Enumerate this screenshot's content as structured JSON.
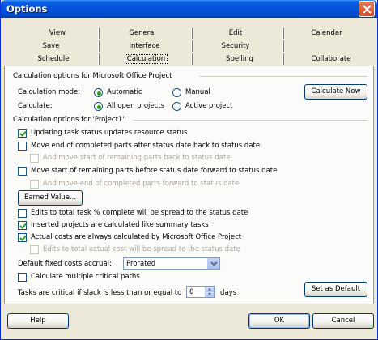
{
  "window": {
    "title": "Options"
  },
  "tabs": {
    "row1": [
      "View",
      "General",
      "Edit",
      "Calendar"
    ],
    "row2": [
      "Save",
      "Interface",
      "Security"
    ],
    "row3": [
      "Schedule",
      "Calculation",
      "Spelling",
      "Collaborate"
    ],
    "selected": "Calculation"
  },
  "calc_options": {
    "title": "Calculation options for Microsoft Office Project",
    "mode_label": "Calculation mode:",
    "mode_options": [
      "Automatic",
      "Manual"
    ],
    "mode_selected": "Automatic",
    "calculate_label": "Calculate:",
    "calculate_options": [
      "All open projects",
      "Active project"
    ],
    "calculate_selected": "All open projects",
    "calculate_now_button": "Calculate Now"
  },
  "project_options": {
    "title": "Calculation options for 'Project1'",
    "items": [
      {
        "label": "Updating task status updates resource status",
        "checked": true,
        "enabled": true
      },
      {
        "label": "Move end of completed parts after status date back to status date",
        "checked": false,
        "enabled": true
      },
      {
        "label": "And move start of remaining parts back to status date",
        "checked": false,
        "enabled": false
      },
      {
        "label": "Move start of remaining parts before status date forward to status date",
        "checked": false,
        "enabled": true
      },
      {
        "label": "And move end of completed parts forward to status date",
        "checked": false,
        "enabled": false
      }
    ],
    "earned_value_button": "Earned Value...",
    "items2": [
      {
        "label": "Edits to total task % complete will be spread to the status date",
        "checked": false,
        "enabled": true
      },
      {
        "label": "Inserted projects are calculated like summary tasks",
        "checked": true,
        "enabled": true
      },
      {
        "label": "Actual costs are always calculated by Microsoft Office Project",
        "checked": true,
        "enabled": true
      },
      {
        "label": "Edits to total actual cost will be spread to the status date",
        "checked": false,
        "enabled": false
      }
    ],
    "fixed_costs_label": "Default fixed costs accrual:",
    "fixed_costs_value": "Prorated",
    "multiple_paths_label": "Calculate multiple critical paths",
    "multiple_paths_checked": false,
    "critical_slack_label": "Tasks are critical if slack is less than or equal to",
    "critical_slack_value": "0",
    "critical_slack_unit": "days",
    "set_default_button": "Set as Default"
  },
  "footer": {
    "help": "Help",
    "ok": "OK",
    "cancel": "Cancel"
  },
  "colors": {
    "title_bar": "#0553dc",
    "radio_dot": "#21a121",
    "check": "#21a121"
  }
}
